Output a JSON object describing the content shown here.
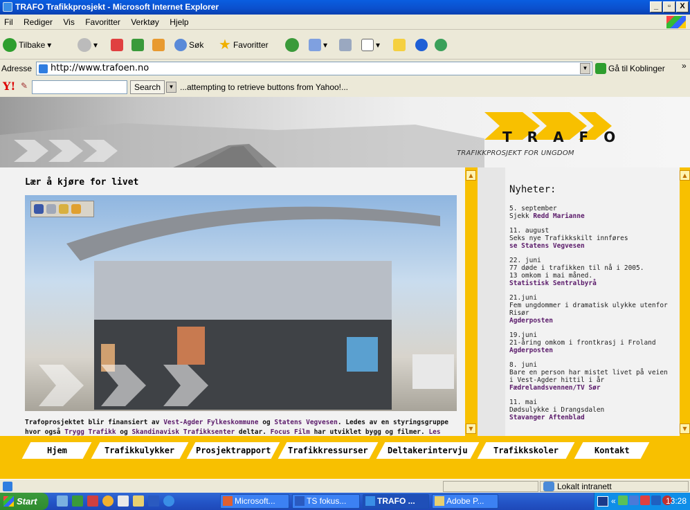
{
  "window": {
    "title": "TRAFO Trafikkprosjekt - Microsoft Internet Explorer",
    "min": "_",
    "max": "̄",
    "close": "X"
  },
  "menu": [
    "Fil",
    "Rediger",
    "Vis",
    "Favoritter",
    "Verktøy",
    "Hjelp"
  ],
  "toolbar": {
    "back": "Tilbake",
    "search": "Søk",
    "favorites": "Favoritter"
  },
  "address": {
    "label": "Adresse",
    "url": "http://www.trafoen.no",
    "go": "Gå til",
    "links": "Koblinger",
    "more": "»"
  },
  "yahoo": {
    "search_btn": "Search",
    "status": "...attempting to retrieve buttons from Yahoo!..."
  },
  "banner": {
    "logo_letters": [
      "T",
      "R",
      "A",
      "F",
      "O"
    ],
    "tagline": "TRAFIKKPROSJEKT FOR UNGDOM"
  },
  "main": {
    "heading": "Lær å kjøre for livet",
    "body_plain_1": "Trafoprosjektet blir finansiert av ",
    "link_1": "Vest-Agder Fylkeskommune",
    "body_plain_2": " og ",
    "link_2": "Statens Vegvesen",
    "body_plain_3": ". Ledes av en styringsgruppe hvor også ",
    "link_3": "Trygg Trafikk",
    "body_plain_4": " og ",
    "link_4": "Skandinavisk Trafikksenter",
    "body_plain_5": " deltar. ",
    "link_5": "Focus Film",
    "body_plain_6": " har utviklet bygg og filmer. ",
    "link_6": "Les mer..."
  },
  "news": {
    "heading": "Nyheter:",
    "items": [
      {
        "date": "5. september",
        "text": "Sjekk ",
        "link": "Redd Marianne"
      },
      {
        "date": "11. august",
        "text": "Seks nye Trafikkskilt innføres",
        "link": "se Statens Vegvesen"
      },
      {
        "date": "22. juni",
        "text": "77 døde i trafikken til nå i 2005.\n13 omkom i mai måned.",
        "link": "Statistisk Sentralbyrå"
      },
      {
        "date": "21.juni",
        "text": "Fem ungdommer i dramatisk ulykke utenfor Risør",
        "link": "Agderposten"
      },
      {
        "date": "19.juni",
        "text": "21-åring omkom i frontkrasj i Froland",
        "link": "Agderposten"
      },
      {
        "date": "8. juni",
        "text": "Bare en person har mistet livet på veien i Vest-Agder hittil i år",
        "link": "Fædrelandsvennen/TV Sør"
      },
      {
        "date": "11. mai",
        "text": "Dødsulykke i Drangsdalen",
        "link": "Stavanger Aftenblad"
      }
    ]
  },
  "nav": [
    "Hjem",
    "Trafikkulykker",
    "Prosjektrapport",
    "Trafikkressurser",
    "Deltakerintervju",
    "Trafikkskoler",
    "Kontakt"
  ],
  "status": {
    "zone": "Lokalt intranett"
  },
  "taskbar": {
    "start": "Start",
    "tasks": [
      "Microsoft...",
      "TS fokus...",
      "TRAFO ...",
      "Adobe P..."
    ],
    "tray_marker": "«",
    "clock": "13:28"
  },
  "colors": {
    "accent": "#f8c000",
    "link": "#5a1a6a",
    "titlebar": "#0b4fcc"
  }
}
